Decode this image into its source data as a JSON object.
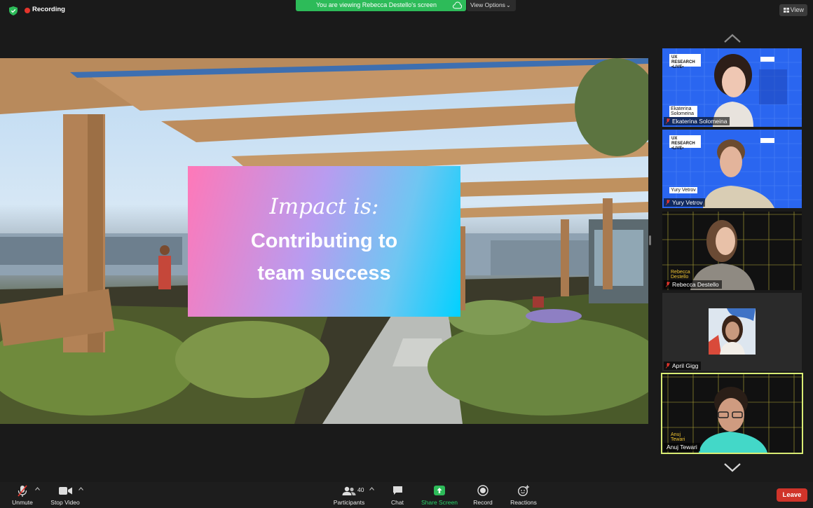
{
  "topbar": {
    "recording_label": "Recording",
    "banner_text": "You are viewing Rebecca Destello's screen",
    "view_options_label": "View Options",
    "view_label": "View"
  },
  "share": {
    "impact_title": "Impact is:",
    "impact_line1": "Contributing to",
    "impact_line2": "team success"
  },
  "gallery": {
    "participants": [
      {
        "name": "Ekaterina Solomeina",
        "slide_badge": "UX RESEARCH •LIVE•",
        "slide_label": "Ekaterina Solomeina"
      },
      {
        "name": "Yury Vetrov",
        "slide_badge": "UX RESEARCH •LIVE•",
        "slide_label": "Yury Vetrov"
      },
      {
        "name": "Rebecca Destello",
        "slide_label": "Rebecca Destello"
      },
      {
        "name": "April Gigg"
      },
      {
        "name": "Anuj Tewari",
        "slide_label": "Anuj Tewari"
      }
    ]
  },
  "toolbar": {
    "unmute": "Unmute",
    "stop_video": "Stop Video",
    "participants": "Participants",
    "participant_count": "40",
    "chat": "Chat",
    "share_screen": "Share Screen",
    "record": "Record",
    "reactions": "Reactions",
    "leave": "Leave"
  },
  "colors": {
    "accent_green": "#2dbb59",
    "leave_red": "#d0342a",
    "recording_red": "#e5352c",
    "active_speaker_border": "#d8eb74"
  }
}
